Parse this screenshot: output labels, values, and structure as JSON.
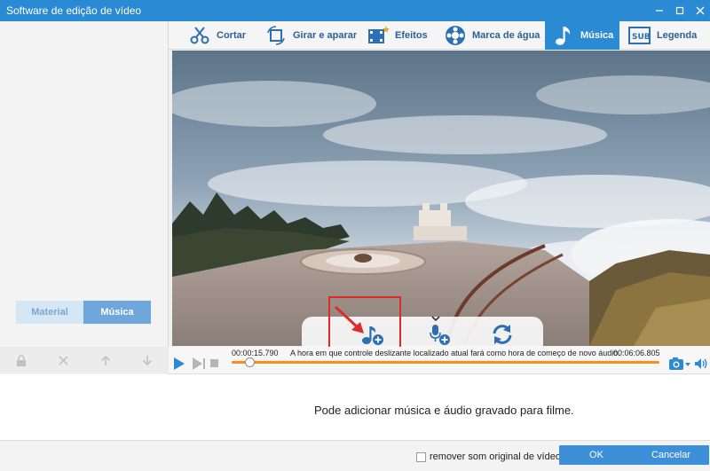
{
  "window": {
    "title": "Software de edição de vídeo"
  },
  "tabs": [
    {
      "label": "Cortar",
      "icon": "scissors-icon"
    },
    {
      "label": "Girar e aparar",
      "icon": "crop-rotate-icon"
    },
    {
      "label": "Efeitos",
      "icon": "effects-icon"
    },
    {
      "label": "Marca de água",
      "icon": "watermark-icon"
    },
    {
      "label": "Música",
      "icon": "music-note-icon",
      "active": true
    },
    {
      "label": "Legenda",
      "icon": "subtitle-icon"
    }
  ],
  "left_panel": {
    "tabs": [
      {
        "label": "Material"
      },
      {
        "label": "Música",
        "active": true
      }
    ],
    "tools": [
      "lock-icon",
      "delete-icon",
      "move-up-icon",
      "move-down-icon"
    ]
  },
  "player": {
    "current_time": "00:00:15.790",
    "end_time": "00:06:06.805",
    "hint": "A hora em que controle deslizante localizado atual fará como hora de começo de novo áudio.",
    "progress": 0.042
  },
  "info": {
    "text": "Pode adicionar música e áudio gravado para filme."
  },
  "footer": {
    "remove_audio_label": "remover som original de vídeo",
    "ok_label": "OK",
    "cancel_label": "Cancelar"
  },
  "colors": {
    "accent": "#2a8ad4",
    "timeline": "#ff8c1a",
    "highlight": "#e02a2a"
  }
}
